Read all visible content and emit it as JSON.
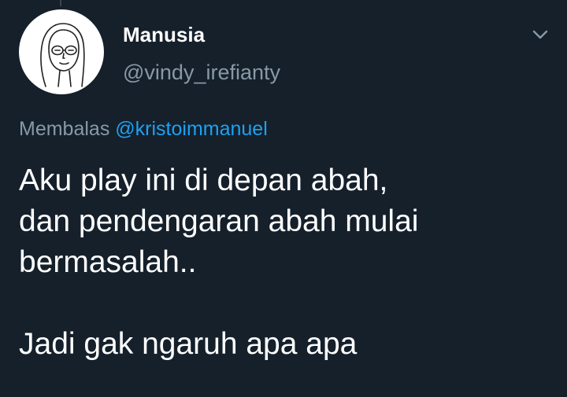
{
  "tweet": {
    "author": {
      "display_name": "Manusia",
      "handle": "@vindy_irefianty",
      "avatar_icon": "line-drawing-face-with-glasses"
    },
    "reply": {
      "prefix": "Membalas",
      "mention": "@kristoimmanuel"
    },
    "text_lines": [
      "Aku play ini di depan abah,",
      "dan pendengaran abah mulai",
      "bermasalah..",
      "Jadi gak ngaruh apa apa"
    ],
    "more_icon": "chevron-down-icon"
  },
  "colors": {
    "background": "#15202b",
    "primary_text": "#ffffff",
    "secondary_text": "#8899a6",
    "accent": "#1da1f2"
  }
}
